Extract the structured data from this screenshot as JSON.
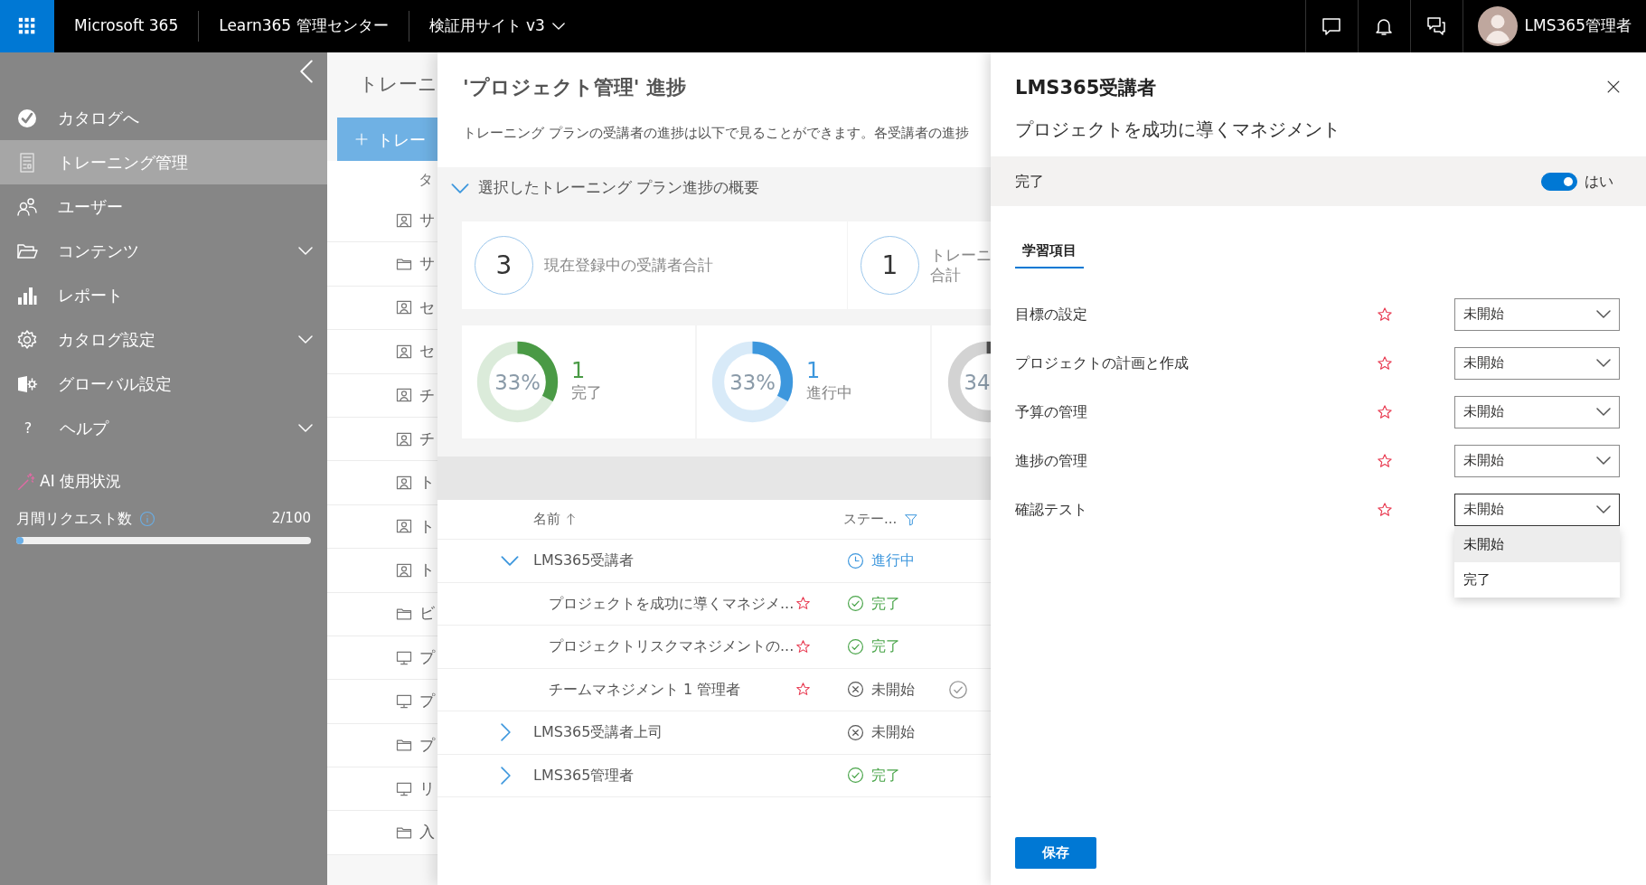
{
  "top_bar": {
    "app_name": "Microsoft 365",
    "admin_center": "Learn365 管理センター",
    "site": "検証用サイト v3",
    "user_name": "LMS365管理者"
  },
  "sidebar": {
    "items": [
      {
        "label": "カタログへ",
        "expandable": false,
        "selected": false
      },
      {
        "label": "トレーニング管理",
        "expandable": false,
        "selected": true
      },
      {
        "label": "ユーザー",
        "expandable": false,
        "selected": false
      },
      {
        "label": "コンテンツ",
        "expandable": true,
        "selected": false
      },
      {
        "label": "レポート",
        "expandable": false,
        "selected": false
      },
      {
        "label": "カタログ設定",
        "expandable": true,
        "selected": false
      },
      {
        "label": "グローバル設定",
        "expandable": false,
        "selected": false
      },
      {
        "label": "ヘルプ",
        "icon_text": "?",
        "expandable": true,
        "selected": false
      }
    ],
    "ai_usage": {
      "title": "AI 使用状況",
      "label": "月間リクエスト数",
      "count": "2/100",
      "level": 0.02
    }
  },
  "background_page": {
    "title": "トレーニ",
    "new_button": "トレー",
    "column_header": "タ",
    "rows": [
      {
        "kind": "person",
        "text": "サ"
      },
      {
        "kind": "folder",
        "text": "サ"
      },
      {
        "kind": "person",
        "text": "セ"
      },
      {
        "kind": "person",
        "text": "セ"
      },
      {
        "kind": "person",
        "text": "チ"
      },
      {
        "kind": "person",
        "text": "チ"
      },
      {
        "kind": "person",
        "text": "ト"
      },
      {
        "kind": "person",
        "text": "ト"
      },
      {
        "kind": "person",
        "text": "ト"
      },
      {
        "kind": "folder",
        "text": "ビ"
      },
      {
        "kind": "monitor",
        "text": "プ"
      },
      {
        "kind": "monitor",
        "text": "プ"
      },
      {
        "kind": "folder",
        "text": "プ"
      },
      {
        "kind": "monitor",
        "text": "リ"
      },
      {
        "kind": "folder",
        "text": "入"
      }
    ]
  },
  "progress_panel": {
    "title": "'プロジェクト管理' 進捗",
    "description": "トレーニング プランの受講者の進捗は以下で見ることができます。各受講者の進捗",
    "summary": {
      "title": "選択したトレーニング プラン進捗の概要",
      "expanded": true,
      "stats": [
        {
          "value": "3",
          "lines": [
            "現在登録中の受講者合計"
          ]
        },
        {
          "value": "1",
          "lines": [
            "トレーニ",
            "合計"
          ]
        }
      ],
      "donuts": [
        {
          "percent": "33%",
          "level": 0.33,
          "count": "1",
          "label": "完了",
          "color": "#4a9a45"
        },
        {
          "percent": "33%",
          "level": 0.33,
          "count": "1",
          "label": "進行中",
          "color": "#3d97dd"
        },
        {
          "percent": "34",
          "color": "#505050"
        }
      ]
    },
    "table": {
      "columns": [
        {
          "label": "名前",
          "sorted": true
        },
        {
          "label": "ステー...",
          "filter": true
        }
      ],
      "rows": [
        {
          "name": "LMS365受講者",
          "expanded": true,
          "status": "進行中",
          "kind": "in_progress",
          "children": [
            {
              "name": "プロジェクトを成功に導くマネジメ...",
              "starred": true,
              "status": "完了",
              "kind": "done",
              "hovered": false
            },
            {
              "name": "プロジェクトリスクマネジメントの...",
              "starred": true,
              "status": "完了",
              "kind": "done",
              "hovered": false
            },
            {
              "name": "チームマネジメント 1 管理者",
              "starred": true,
              "status": "未開始",
              "kind": "not_started",
              "hovered": true
            }
          ]
        },
        {
          "name": "LMS365受講者上司",
          "expanded": false,
          "status": "未開始",
          "kind": "not_started"
        },
        {
          "name": "LMS365管理者",
          "expanded": false,
          "status": "完了",
          "kind": "done"
        }
      ]
    }
  },
  "detail_panel": {
    "title": "LMS365受講者",
    "subtitle": "プロジェクトを成功に導くマネジメント",
    "complete": {
      "label": "完了",
      "on": true,
      "value_text": "はい"
    },
    "tabs": [
      {
        "label": "学習項目",
        "selected": true
      }
    ],
    "items": [
      {
        "name": "目標の設定",
        "starred": true,
        "value": "未開始",
        "open": false
      },
      {
        "name": "プロジェクトの計画と作成",
        "starred": true,
        "value": "未開始",
        "open": false
      },
      {
        "name": "予算の管理",
        "starred": true,
        "value": "未開始",
        "open": false
      },
      {
        "name": "進捗の管理",
        "starred": true,
        "value": "未開始",
        "open": false
      },
      {
        "name": "確認テスト",
        "starred": true,
        "value": "未開始",
        "open": true
      }
    ],
    "open_options": [
      {
        "label": "未開始",
        "selected": true
      },
      {
        "label": "完了",
        "selected": false
      }
    ],
    "save_button": "保存"
  }
}
